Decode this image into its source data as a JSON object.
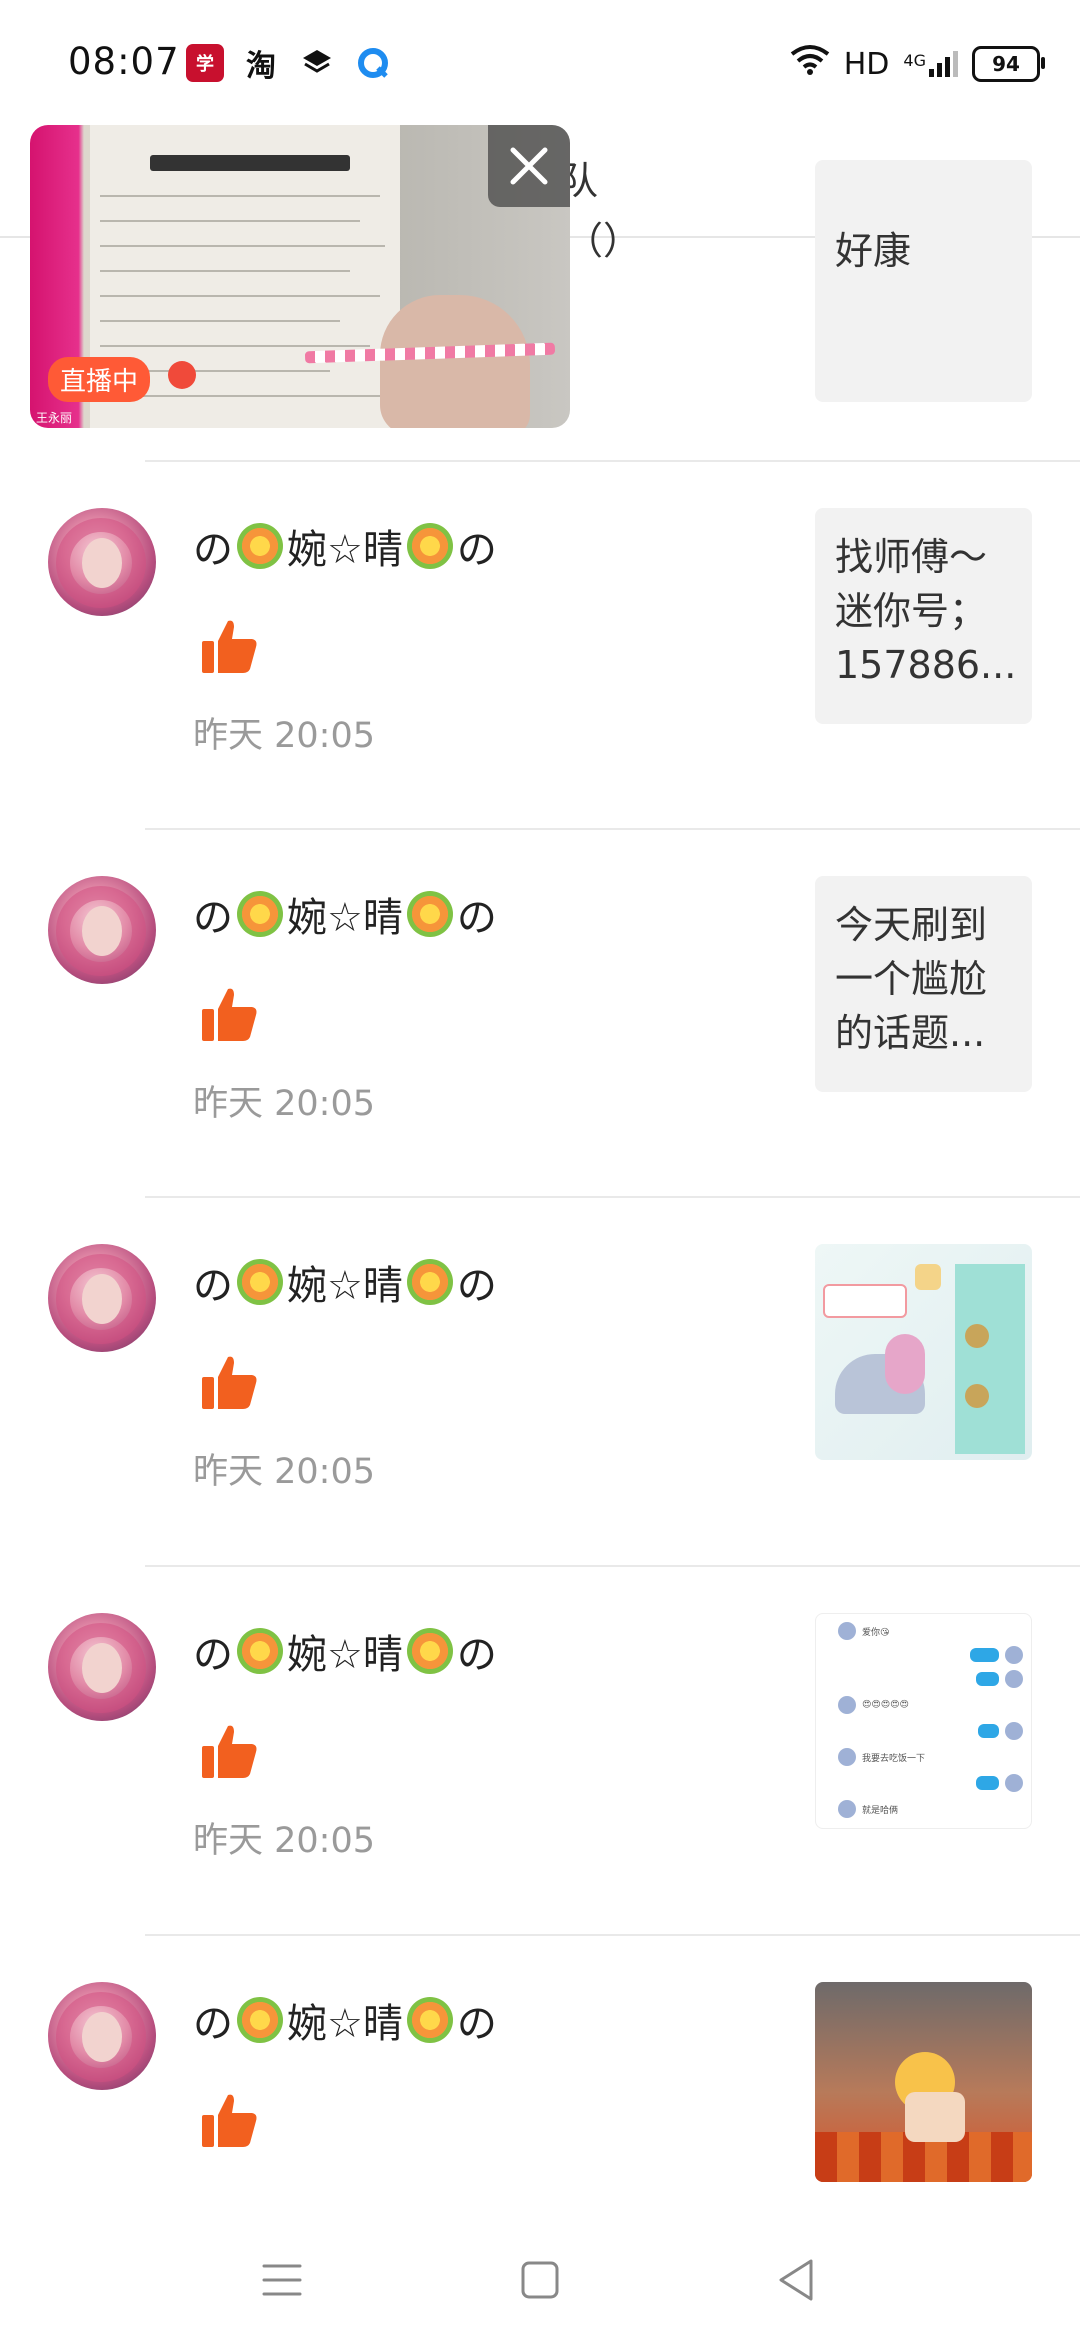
{
  "status_bar": {
    "time": "08:07",
    "apps": [
      "app-red-icon",
      "淘",
      "layers-icon",
      "browser-icon"
    ],
    "network": "HD",
    "signal_label": "4G",
    "battery": "94"
  },
  "header": {
    "title": "队"
  },
  "partial_item": {
    "quote_text": "好康",
    "bracket": "（）"
  },
  "pip": {
    "live_label": "直播中",
    "caption": "王永丽",
    "close_icon": "close-icon"
  },
  "items": [
    {
      "username_parts": [
        "の",
        "婉☆晴",
        "の"
      ],
      "time": "昨天 20:05",
      "thumb_type": "text",
      "quote": "找师傅～迷你号；157886..."
    },
    {
      "username_parts": [
        "の",
        "婉☆晴",
        "の"
      ],
      "time": "昨天 20:05",
      "thumb_type": "text",
      "quote": "今天刷到一个尴尬的话题..."
    },
    {
      "username_parts": [
        "の",
        "婉☆晴",
        "の"
      ],
      "time": "昨天 20:05",
      "thumb_type": "image-game",
      "quote": ""
    },
    {
      "username_parts": [
        "の",
        "婉☆晴",
        "の"
      ],
      "time": "昨天 20:05",
      "thumb_type": "image-chat",
      "quote": ""
    },
    {
      "username_parts": [
        "の",
        "婉☆晴",
        "の"
      ],
      "time": "",
      "thumb_type": "image-scene",
      "quote": ""
    }
  ],
  "chat_thumb": {
    "lines": [
      "爱你😘",
      "😍😍😍😍😍",
      "我要去吃饭一下",
      "就是哈俩"
    ]
  },
  "nav": {
    "menu_icon": "menu-icon",
    "home_icon": "home-icon",
    "back_icon": "back-icon"
  },
  "colors": {
    "accent": "#f2601f",
    "live": "#ff5a36",
    "timestamp": "#9a9a9a"
  }
}
